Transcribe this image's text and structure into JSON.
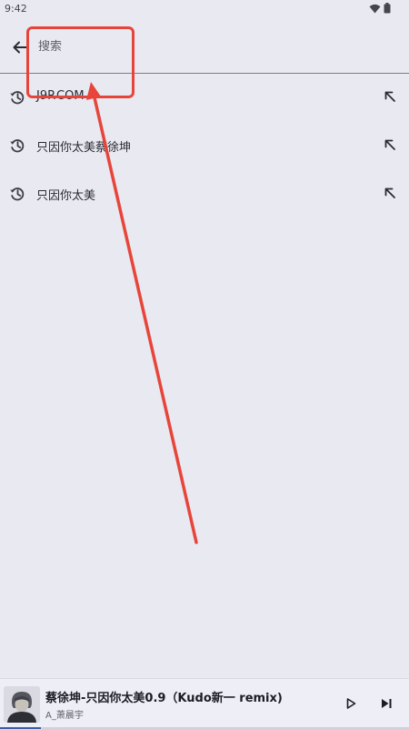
{
  "status_bar": {
    "time": "9:42",
    "icons": [
      "wifi-icon",
      "battery-icon"
    ]
  },
  "search": {
    "placeholder": "搜索",
    "value": ""
  },
  "history": [
    {
      "label": "J9P.COM"
    },
    {
      "label": "只因你太美蔡徐坤"
    },
    {
      "label": "只因你太美"
    }
  ],
  "player": {
    "title": "蔡徐坤-只因你太美0.9（Kudo新一 remix)",
    "artist": "A_萧晨宇",
    "progress": 0.1
  },
  "colors": {
    "background": "#e8e9f1",
    "annotation": "#e8453a",
    "accent": "#3a5fa8"
  }
}
